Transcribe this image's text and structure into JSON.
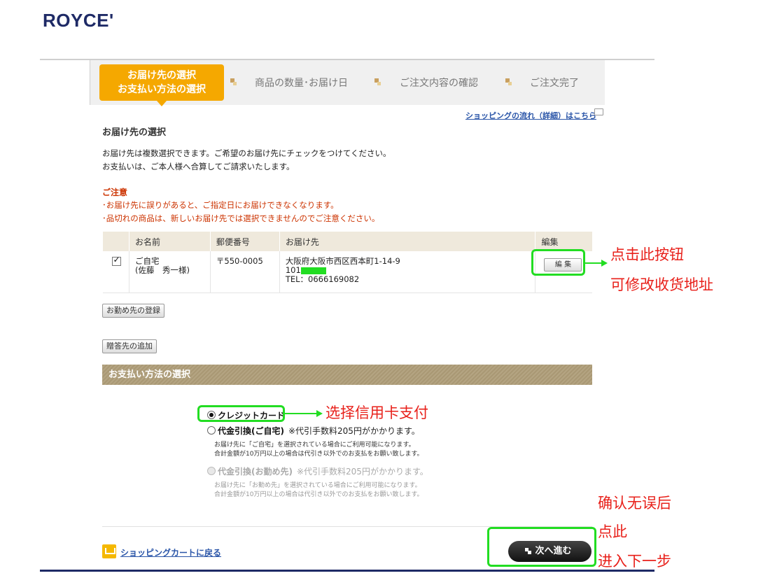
{
  "brand": {
    "logo": "ROYCE'"
  },
  "steps": {
    "active_line1": "お届け先の選択",
    "active_line2": "お支払い方法の選択",
    "step2": "商品の数量･お届け日",
    "step3": "ご注文内容の確認",
    "step4": "ご注文完了"
  },
  "flow_link": "ショッピングの流れ（詳細）はこちら",
  "delivery": {
    "title": "お届け先の選択",
    "desc1": "お届け先は複数選択できます。ご希望のお届け先にチェックをつけてください。",
    "desc2": "お支払いは、ご本人様へ合算してご請求いたします。",
    "caution_title": "ご注意",
    "caution1": "･お届け先に誤りがあると、ご指定日にお届けできなくなります。",
    "caution2": "･品切れの商品は、新しいお届け先では選択できませんのでご注意ください。"
  },
  "table": {
    "headers": {
      "name": "お名前",
      "postal": "郵便番号",
      "address": "お届け先",
      "edit": "編集"
    },
    "row": {
      "checked": true,
      "name1": "ご自宅",
      "name2": "(佐藤　秀一様)",
      "postal": "〒550-0005",
      "addr1": "大阪府大阪市西区西本町1-14-9",
      "addr2": "101",
      "tel": "TEL：0666169082",
      "edit_label": "編 集"
    }
  },
  "buttons": {
    "register_office": "お勤め先の登録",
    "add_gift": "贈答先の追加"
  },
  "payment": {
    "title": "お支払い方法の選択",
    "option1": "クレジットカード",
    "option2": "代金引換(ご自宅)",
    "option2_fee": "※代引手数料205円がかかります。",
    "option2_note1": "お届け先に「ご自宅」を選択されている場合にご利用可能になります。",
    "option2_note2": "合計金額が10万円以上の場合は代引き以外でのお支払をお願い致します。",
    "option3": "代金引換(お勤め先)",
    "option3_fee": "※代引手数料205円がかかります。",
    "option3_note1": "お届け先に「お勤め先」を選択されている場合にご利用可能になります。",
    "option3_note2": "合計金額が10万円以上の場合は代引き以外でのお支払をお願い致します。"
  },
  "footer": {
    "back_cart": "ショッピングカートに戻る",
    "next": "次へ進む"
  },
  "annotations": {
    "edit_line1": "点击此按钮",
    "edit_line2": "可修改收货地址",
    "credit": "选择信用卡支付",
    "next_line1": "确认无误后",
    "next_line2": "点此",
    "next_line3": "进入下一步"
  },
  "colors": {
    "accent": "#f5a800",
    "link": "#2a55a8",
    "caution": "#cc3300",
    "highlight": "#22dd22",
    "annotation": "#e8201a",
    "brand": "#1e2a66"
  }
}
